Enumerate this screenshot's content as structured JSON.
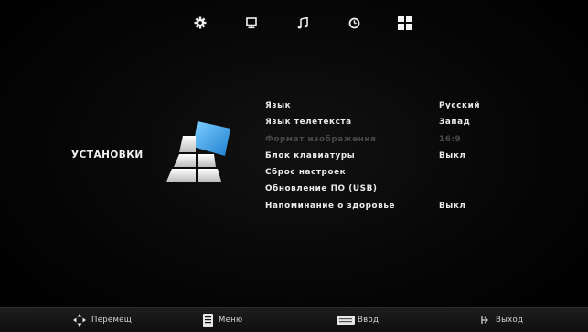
{
  "tabs": [
    {
      "icon": "gear-icon"
    },
    {
      "icon": "monitor-icon"
    },
    {
      "icon": "music-note-icon"
    },
    {
      "icon": "clock-icon"
    },
    {
      "icon": "grid-icon",
      "active": true
    }
  ],
  "section": {
    "title": "УСТАНОВКИ",
    "logo": "setup-logo-icon"
  },
  "menu": {
    "items": [
      {
        "label": "Язык",
        "value": "Русский"
      },
      {
        "label": "Язык телетекста",
        "value": "Запад"
      },
      {
        "label": "Формат изображения",
        "value": "16:9",
        "disabled": true
      },
      {
        "label": "Блок клавиатуры",
        "value": "Выкл"
      },
      {
        "label": "Сброс настроек",
        "value": ""
      },
      {
        "label": "Обновление ПО (USB)",
        "value": ""
      },
      {
        "label": "Напоминание о здоровье",
        "value": "Выкл"
      }
    ]
  },
  "bottom_bar": {
    "move_label": "Перемещ",
    "menu_label": "Меню",
    "enter_label": "Ввод",
    "exit_label": "Выход"
  },
  "colors": {
    "background": "#000000",
    "text": "#ececec",
    "disabled_text": "#4a4a4a",
    "logo_blue": "#3a9ee8"
  }
}
